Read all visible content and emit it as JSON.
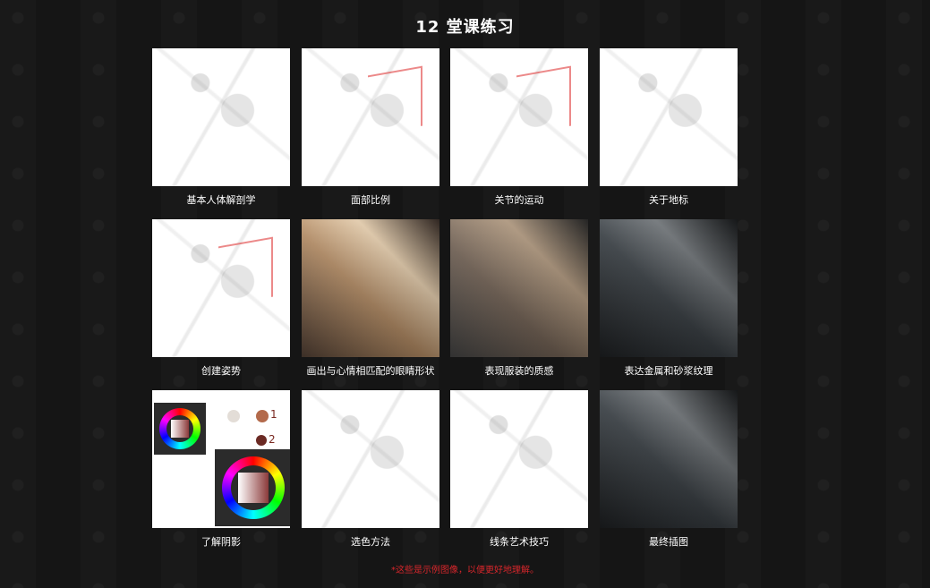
{
  "title": "12 堂课练习",
  "tiles": [
    {
      "label": "基本人体解剖学",
      "style": "sketch"
    },
    {
      "label": "面部比例",
      "style": "sketch red"
    },
    {
      "label": "关节的运动",
      "style": "sketch red"
    },
    {
      "label": "关于地标",
      "style": "sketch"
    },
    {
      "label": "创建姿势",
      "style": "sketch red"
    },
    {
      "label": "画出与心情相匹配的眼睛形状",
      "style": "photo warm"
    },
    {
      "label": "表现服装的质感",
      "style": "photo"
    },
    {
      "label": "表达金属和砂浆纹理",
      "style": "photo dark"
    },
    {
      "label": "了解阴影",
      "style": "color"
    },
    {
      "label": "选色方法",
      "style": "sketch"
    },
    {
      "label": "线条艺术技巧",
      "style": "sketch"
    },
    {
      "label": "最终插图",
      "style": "photo dark"
    }
  ],
  "note": "*这些是示例图像，以便更好地理解。",
  "colors": {
    "background": "#151515",
    "note_red": "#d7262b"
  },
  "icons": {
    "palette_numbers": [
      "1",
      "2"
    ]
  }
}
